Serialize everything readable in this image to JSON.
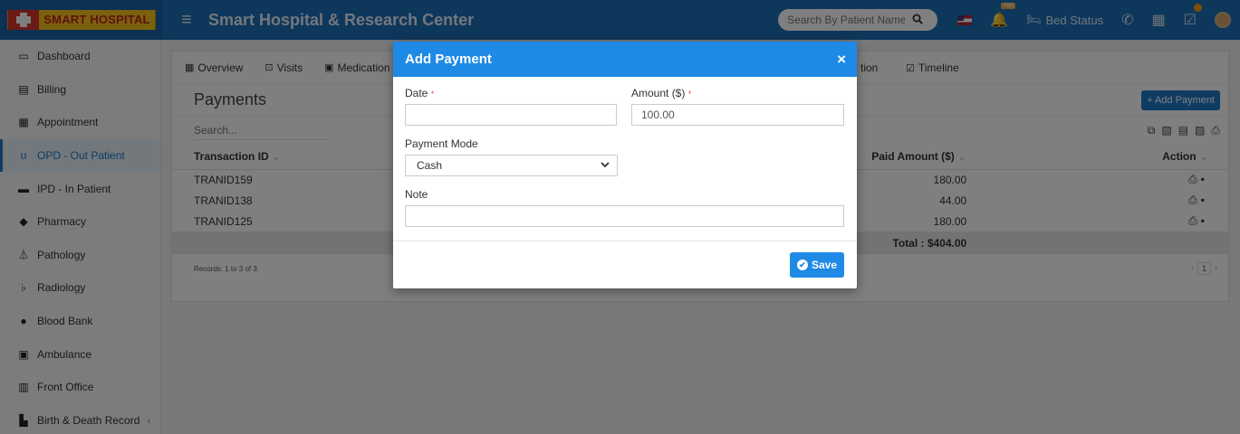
{
  "header": {
    "logo_text": "SMART HOSPITAL",
    "menu_icon": "hamburger-icon",
    "title": "Smart Hospital & Research Center",
    "search_placeholder": "Search By Patient Name",
    "notification_badge": "766",
    "bed_status_label": "Bed Status",
    "colors": {
      "brand": "#1d6fb8",
      "accent": "#1e8ae6"
    }
  },
  "sidebar": {
    "items": [
      {
        "label": "Dashboard",
        "icon": "monitor-icon"
      },
      {
        "label": "Billing",
        "icon": "file-icon"
      },
      {
        "label": "Appointment",
        "icon": "calendar-icon"
      },
      {
        "label": "OPD - Out Patient",
        "icon": "stethoscope-icon",
        "active": true
      },
      {
        "label": "IPD - In Patient",
        "icon": "bed-icon"
      },
      {
        "label": "Pharmacy",
        "icon": "mortar-icon"
      },
      {
        "label": "Pathology",
        "icon": "flask-icon"
      },
      {
        "label": "Radiology",
        "icon": "microscope-icon"
      },
      {
        "label": "Blood Bank",
        "icon": "drop-icon"
      },
      {
        "label": "Ambulance",
        "icon": "ambulance-icon"
      },
      {
        "label": "Front Office",
        "icon": "building-icon"
      },
      {
        "label": "Birth & Death Record",
        "icon": "family-icon"
      }
    ]
  },
  "tabs": {
    "overview": "Overview",
    "visits": "Visits",
    "medication": "Medication",
    "partial": "tion",
    "timeline": "Timeline"
  },
  "payments": {
    "title": "Payments",
    "add_button": "Add Payment",
    "search_placeholder": "Search...",
    "columns": {
      "transaction_id": "Transaction ID",
      "paid_amount": "Paid Amount ($)",
      "action": "Action"
    },
    "rows": [
      {
        "id": "TRANID159",
        "amount": "180.00"
      },
      {
        "id": "TRANID138",
        "amount": "44.00"
      },
      {
        "id": "TRANID125",
        "amount": "180.00"
      }
    ],
    "total": "Total : $404.00",
    "records": "Records: 1 to 3 of 3",
    "page": "1"
  },
  "modal": {
    "title": "Add Payment",
    "date_label": "Date",
    "date_value": "",
    "amount_label": "Amount ($)",
    "amount_value": "100.00",
    "mode_label": "Payment Mode",
    "mode_value": "Cash",
    "note_label": "Note",
    "note_value": "",
    "save_label": "Save",
    "required_mark": "*"
  }
}
